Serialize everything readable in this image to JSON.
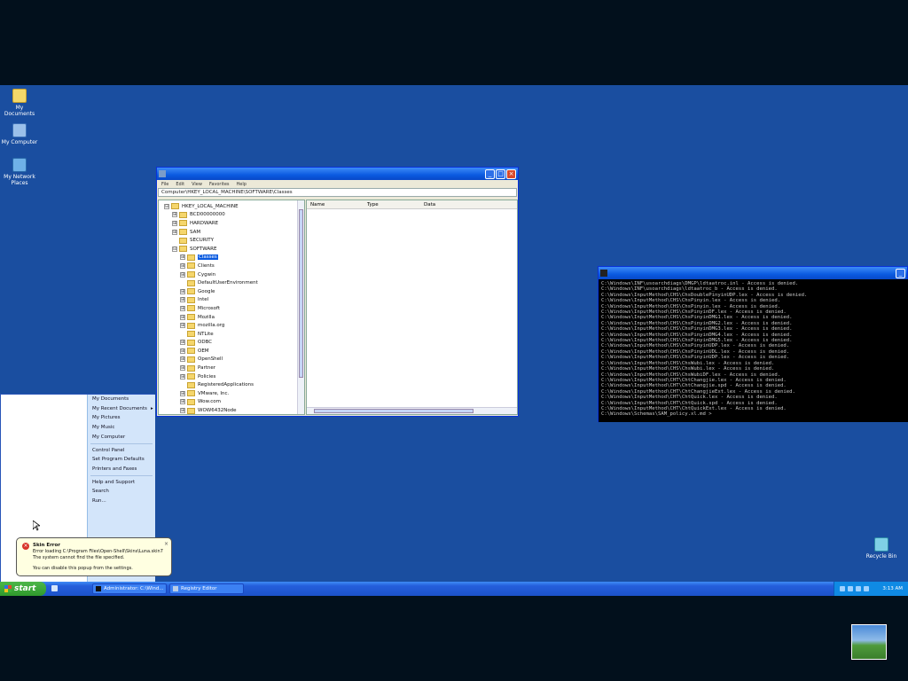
{
  "desktop": {
    "icons": [
      {
        "label": "My Documents",
        "icon": "my-documents-icon"
      },
      {
        "label": "My Computer",
        "icon": "my-computer-icon"
      },
      {
        "label": "My Network Places",
        "icon": "network-places-icon"
      },
      {
        "label": "Recycle Bin",
        "icon": "recycle-bin-icon"
      }
    ]
  },
  "regedit": {
    "title": "",
    "menu": [
      "File",
      "Edit",
      "View",
      "Favorites",
      "Help"
    ],
    "address": "Computer\\HKEY_LOCAL_MACHINE\\SOFTWARE\\Classes",
    "columns": [
      "Name",
      "Type",
      "Data"
    ],
    "tree": [
      {
        "label": "HKEY_LOCAL_MACHINE",
        "expander": "⊟"
      },
      {
        "label": "BCD00000000",
        "expander": "⊞"
      },
      {
        "label": "HARDWARE",
        "expander": "⊞"
      },
      {
        "label": "SAM",
        "expander": "⊞"
      },
      {
        "label": "SECURITY",
        "expander": ""
      },
      {
        "label": "SOFTWARE",
        "expander": "⊟"
      },
      {
        "label": "Classes",
        "expander": "⊞",
        "selected": true
      },
      {
        "label": "Clients",
        "expander": "⊞"
      },
      {
        "label": "Cygwin",
        "expander": "⊞"
      },
      {
        "label": "DefaultUserEnvironment",
        "expander": ""
      },
      {
        "label": "Google",
        "expander": "⊞"
      },
      {
        "label": "Intel",
        "expander": "⊞"
      },
      {
        "label": "Microsoft",
        "expander": "⊞"
      },
      {
        "label": "Mozilla",
        "expander": "⊞"
      },
      {
        "label": "mozilla.org",
        "expander": "⊞"
      },
      {
        "label": "NTLite",
        "expander": ""
      },
      {
        "label": "ODBC",
        "expander": "⊞"
      },
      {
        "label": "OEM",
        "expander": "⊞"
      },
      {
        "label": "OpenShell",
        "expander": "⊞"
      },
      {
        "label": "Partner",
        "expander": "⊞"
      },
      {
        "label": "Policies",
        "expander": "⊞"
      },
      {
        "label": "RegisteredApplications",
        "expander": ""
      },
      {
        "label": "VMware, Inc.",
        "expander": "⊞"
      },
      {
        "label": "Wow.com",
        "expander": "⊞"
      },
      {
        "label": "WOW6432Node",
        "expander": "⊞"
      }
    ]
  },
  "console": {
    "title": "",
    "lines": [
      "C:\\Windows\\INF\\usoarchdiags\\DMGP\\ldtaatroc.inl - Access is denied.",
      "C:\\Windows\\INF\\usoarchdiags\\ldtaatroc_b - Access is denied.",
      "C:\\Windows\\InputMethod\\CHS\\ChsDoublePinyinUDP.lex - Access is denied.",
      "C:\\Windows\\InputMethod\\CHS\\ChsPinyin.lex - Access is denied.",
      "C:\\Windows\\InputMethod\\CHS\\ChsPinyin.lex - Access is denied.",
      "C:\\Windows\\InputMethod\\CHS\\ChsPinyinDF.lex - Access is denied.",
      "C:\\Windows\\InputMethod\\CHS\\ChsPinyinDMG1.lex - Access is denied.",
      "C:\\Windows\\InputMethod\\CHS\\ChsPinyinDMG2.lex - Access is denied.",
      "C:\\Windows\\InputMethod\\CHS\\ChsPinyinDMG3.lex - Access is denied.",
      "C:\\Windows\\InputMethod\\CHS\\ChsPinyinDMG4.lex - Access is denied.",
      "C:\\Windows\\InputMethod\\CHS\\ChsPinyinDMG5.lex - Access is denied.",
      "C:\\Windows\\InputMethod\\CHS\\ChsPinyinUDP.lex - Access is denied.",
      "C:\\Windows\\InputMethod\\CHS\\ChsPinyinUDL.lex - Access is denied.",
      "C:\\Windows\\InputMethod\\CHS\\ChsPinyinUDP.lex - Access is denied.",
      "C:\\Windows\\InputMethod\\CHS\\ChsWubi.lex - Access is denied.",
      "C:\\Windows\\InputMethod\\CHS\\ChsWubi.lex - Access is denied.",
      "C:\\Windows\\InputMethod\\CHS\\ChsWubiDF.lex - Access is denied.",
      "C:\\Windows\\InputMethod\\CHT\\ChtChangjie.lex - Access is denied.",
      "C:\\Windows\\InputMethod\\CHT\\ChtChangjie.spd - Access is denied.",
      "C:\\Windows\\InputMethod\\CHT\\ChtChangjieExt.lex - Access is denied.",
      "C:\\Windows\\InputMethod\\CHT\\ChtQuick.lex - Access is denied.",
      "C:\\Windows\\InputMethod\\CHT\\ChtQuick.spd - Access is denied.",
      "C:\\Windows\\InputMethod\\CHT\\ChtQuickExt.lex - Access is denied.",
      "C:\\Windows\\Schemas\\SAM_policy.xl.md >"
    ]
  },
  "start_menu": {
    "items": [
      "My Documents",
      "My Recent Documents",
      "My Pictures",
      "My Music",
      "My Computer",
      "Control Panel",
      "Set Program Defaults",
      "Printers and Faxes",
      "Help and Support",
      "Search",
      "Run..."
    ]
  },
  "balloon": {
    "title": "Skin Error",
    "line1": "Error loading C:\\Program Files\\Open-Shell\\Skins\\Luna.skin7",
    "line2": "The system cannot find the file specified.",
    "line3": "You can disable this popup from the settings."
  },
  "taskbar": {
    "start_label": "start",
    "tasks": [
      "Administrator: C:\\Wind...",
      "Registry Editor"
    ],
    "clock": "3:13 AM"
  }
}
